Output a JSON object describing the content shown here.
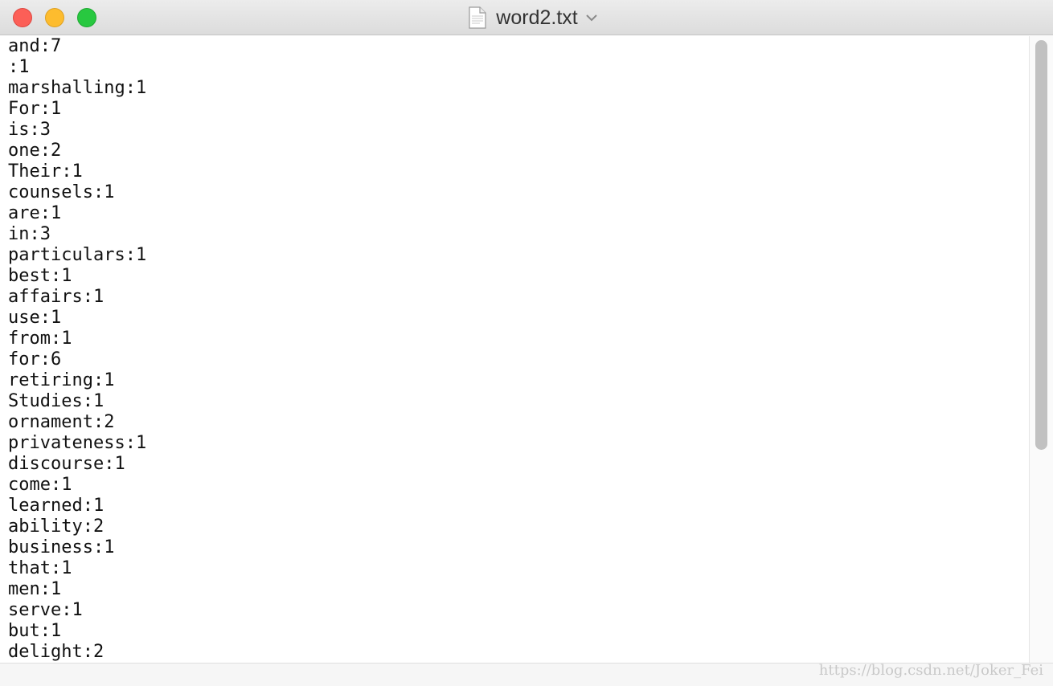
{
  "window": {
    "title": "word2.txt",
    "controls": {
      "close": "close",
      "minimize": "minimize",
      "zoom": "zoom"
    },
    "colors": {
      "close": "#fc5f57",
      "minimize": "#fdbc2e",
      "zoom": "#28c840"
    }
  },
  "editor": {
    "lines": [
      "and:7",
      ":1",
      "marshalling:1",
      "For:1",
      "is:3",
      "one:2",
      "Their:1",
      "counsels:1",
      "are:1",
      "in:3",
      "particulars:1",
      "best:1",
      "affairs:1",
      "use:1",
      "from:1",
      "for:6",
      "retiring:1",
      "Studies:1",
      "ornament:2",
      "privateness:1",
      "discourse:1",
      "come:1",
      "learned:1",
      "ability:2",
      "business:1",
      "that:1",
      "men:1",
      "serve:1",
      "but:1",
      "delight:2"
    ]
  },
  "watermark": "https://blog.csdn.net/Joker_Fei"
}
